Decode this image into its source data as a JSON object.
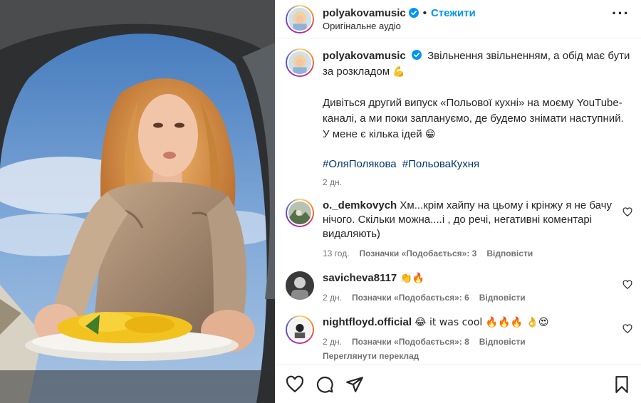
{
  "header": {
    "username": "polyakovamusic",
    "separator": "•",
    "follow_label": "Стежити",
    "audio": "Оригінальне аудіо",
    "more_label": "···"
  },
  "caption": {
    "username": "polyakovamusic",
    "line1": "Звільнення звільненням, а обід має бути за розкладом",
    "line1_emoji": "💪",
    "para2": "Дивіться другий випуск «Польової кухні» на моєму YouTube-каналі, а ми поки заплануємо, де будемо знімати наступний. У мене є кілька ідей",
    "para2_emoji": "😁",
    "tags": [
      "#ОляПолякова",
      "#ПольоваКухня"
    ],
    "time": "2 дн."
  },
  "comments": [
    {
      "username": "o._demkovych",
      "text": "Хм...крім хайпу на цьому і крінжу я не бачу нічого. Скільки можна....і , до речі, негативні коментарі видаляють)",
      "time": "13 год.",
      "likes": "Позначки «Подобається»: 3",
      "reply": "Відповісти"
    },
    {
      "username": "savicheva8117",
      "text": "👏🔥",
      "time": "2 дн.",
      "likes": "Позначки «Подобається»: 6",
      "reply": "Відповісти"
    },
    {
      "username": "nightfloyd.official",
      "text": "😂 it was cool 🔥🔥🔥 👌😍",
      "time": "2 дн.",
      "likes": "Позначки «Подобається»: 8",
      "reply": "Відповісти",
      "translate": "Переглянути переклад"
    }
  ],
  "icons": {
    "more": "more-icon",
    "verified": "verified-icon",
    "like": "heart-icon",
    "comment": "comment-icon",
    "share": "share-icon",
    "save": "bookmark-icon"
  },
  "colors": {
    "accent": "#0095f6",
    "hashtag": "#00376b",
    "muted": "#737373"
  }
}
